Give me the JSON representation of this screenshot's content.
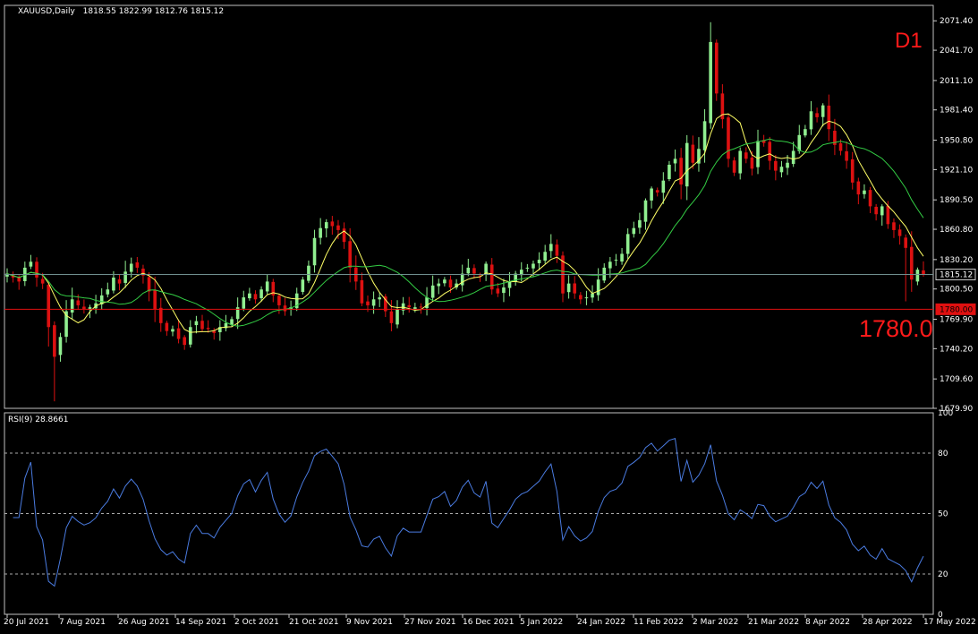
{
  "window": {
    "title": "XAUUSD,Daily",
    "ohlc": "1818.55 1822.99 1812.76 1815.12",
    "timeframe_label": "D1",
    "level_label": "1780.0"
  },
  "chart_data": [
    {
      "type": "candlestick",
      "symbol": "XAUUSD",
      "timeframe": "Daily",
      "ylim": [
        1679.9,
        2087.0
      ],
      "y_ticks": [
        "2071.40",
        "2041.70",
        "2011.10",
        "1981.40",
        "1950.80",
        "1921.10",
        "1890.50",
        "1860.80",
        "1830.20",
        "1800.50",
        "1769.90",
        "1740.20",
        "1709.60",
        "1679.90"
      ],
      "x_ticks": [
        "20 Jul 2021",
        "7 Aug 2021",
        "26 Aug 2021",
        "14 Sep 2021",
        "2 Oct 2021",
        "21 Oct 2021",
        "9 Nov 2021",
        "27 Nov 2021",
        "16 Dec 2021",
        "5 Jan 2022",
        "24 Jan 2022",
        "11 Feb 2022",
        "2 Mar 2022",
        "21 Mar 2022",
        "8 Apr 2022",
        "28 Apr 2022",
        "17 May 2022"
      ],
      "close_path": [
        1816,
        1812,
        1808,
        1822,
        1828,
        1812,
        1806,
        1762,
        1732,
        1752,
        1778,
        1790,
        1784,
        1780,
        1782,
        1786,
        1794,
        1800,
        1812,
        1806,
        1818,
        1826,
        1822,
        1814,
        1798,
        1780,
        1766,
        1758,
        1760,
        1750,
        1744,
        1762,
        1768,
        1760,
        1760,
        1756,
        1762,
        1766,
        1770,
        1782,
        1792,
        1796,
        1790,
        1800,
        1808,
        1794,
        1784,
        1778,
        1782,
        1796,
        1810,
        1824,
        1852,
        1862,
        1868,
        1864,
        1860,
        1848,
        1822,
        1808,
        1786,
        1784,
        1790,
        1792,
        1778,
        1766,
        1780,
        1786,
        1782,
        1782,
        1782,
        1792,
        1804,
        1806,
        1810,
        1802,
        1806,
        1816,
        1822,
        1816,
        1814,
        1826,
        1800,
        1796,
        1802,
        1808,
        1816,
        1820,
        1822,
        1826,
        1830,
        1838,
        1846,
        1834,
        1796,
        1806,
        1796,
        1790,
        1792,
        1796,
        1810,
        1822,
        1828,
        1830,
        1836,
        1856,
        1862,
        1870,
        1890,
        1902,
        1898,
        1910,
        1926,
        1932,
        1906,
        1948,
        1928,
        1942,
        1970,
        2050,
        1998,
        1972,
        1932,
        1918,
        1940,
        1932,
        1922,
        1950,
        1948,
        1930,
        1920,
        1924,
        1928,
        1940,
        1956,
        1962,
        1980,
        1974,
        1986,
        1962,
        1946,
        1940,
        1930,
        1908,
        1896,
        1900,
        1884,
        1876,
        1884,
        1866,
        1860,
        1854,
        1842,
        1810,
        1820,
        1815.12
      ],
      "series": [
        {
          "name": "",
          "color": "#ffff66",
          "period": 20
        },
        {
          "name": "",
          "color": "#33cc44",
          "period": 50
        }
      ],
      "horizontal_lines": [
        {
          "value": 1815.12,
          "color": "#6f8f8f",
          "label": "1815.12"
        },
        {
          "value": 1780.0,
          "color": "#e01010",
          "label": "1780.00"
        }
      ],
      "colors": {
        "bull": "#90ee90",
        "bear": "#dd1111",
        "background": "#000000",
        "grid": "#c0c0c0"
      }
    },
    {
      "type": "line",
      "title": "RSI(9) 28.8661",
      "ylim": [
        0,
        100
      ],
      "y_ticks": [
        "100",
        "80",
        "50",
        "20",
        "0"
      ],
      "levels": [
        80,
        50,
        20
      ],
      "series": [
        {
          "name": "RSI(9)",
          "color": "#4a7be0",
          "last_value": 28.8661
        }
      ]
    }
  ]
}
